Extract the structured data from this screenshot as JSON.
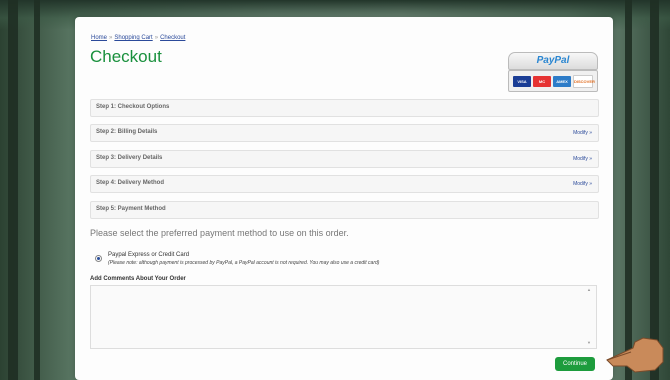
{
  "breadcrumb": {
    "home": "Home",
    "sep": "»",
    "cart": "Shopping Cart",
    "checkout": "Checkout"
  },
  "page": {
    "title": "Checkout"
  },
  "paypal": {
    "logo_a": "Pay",
    "logo_b": "Pal",
    "cards": [
      "VISA",
      "MC",
      "AMEX",
      "DISCOVER"
    ]
  },
  "steps": [
    {
      "label": "Step 1: Checkout Options",
      "modify": ""
    },
    {
      "label": "Step 2: Billing Details",
      "modify": "Modify »"
    },
    {
      "label": "Step 3: Delivery Details",
      "modify": "Modify »"
    },
    {
      "label": "Step 4: Delivery Method",
      "modify": "Modify »"
    },
    {
      "label": "Step 5: Payment Method",
      "modify": ""
    }
  ],
  "payment": {
    "prompt": "Please select the preferred payment method to use on this order.",
    "option": "Paypal Express or Credit Card",
    "note": "(Please note: although payment is processed by PayPal, a PayPal account is not required. You may also use a credit card)"
  },
  "comments": {
    "label": "Add Comments About Your Order",
    "value": ""
  },
  "actions": {
    "continue": "Continue"
  },
  "colors": {
    "accent_green": "#19903d",
    "button_green": "#1d9c3d",
    "link_blue": "#2b4a9a"
  }
}
